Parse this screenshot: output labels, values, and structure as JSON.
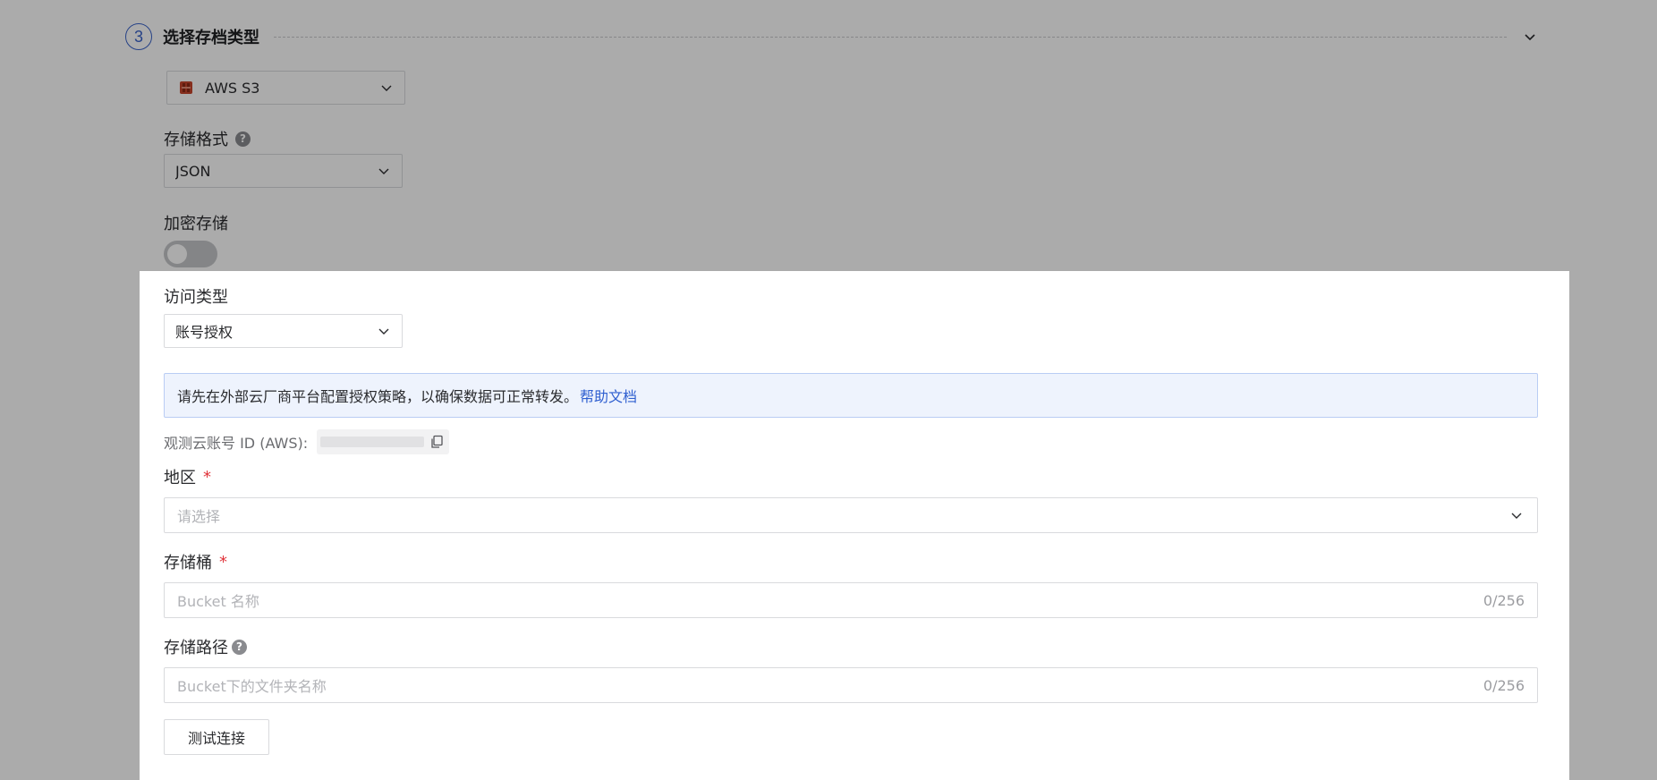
{
  "step": {
    "number": "3",
    "title": "选择存档类型"
  },
  "archive_type": {
    "selected": "AWS S3",
    "icon": "aws-s3-icon"
  },
  "storage_format": {
    "label": "存储格式",
    "selected": "JSON"
  },
  "encryption": {
    "label": "加密存储",
    "enabled": false
  },
  "access_type": {
    "label": "访问类型",
    "selected": "账号授权"
  },
  "alert": {
    "text": "请先在外部云厂商平台配置授权策略，以确保数据可正常转发。",
    "link_text": "帮助文档"
  },
  "account": {
    "label": "观测云账号 ID (AWS):"
  },
  "region": {
    "label": "地区",
    "placeholder": "请选择"
  },
  "bucket": {
    "label": "存储桶",
    "placeholder": "Bucket 名称",
    "count": "0/256"
  },
  "path": {
    "label": "存储路径",
    "placeholder": "Bucket下的文件夹名称",
    "count": "0/256"
  },
  "test_button": {
    "label": "测试连接"
  },
  "colors": {
    "accent": "#3a63c9",
    "link": "#2f5fd0",
    "required": "#e0333a",
    "alert_bg": "#eef3fd"
  }
}
